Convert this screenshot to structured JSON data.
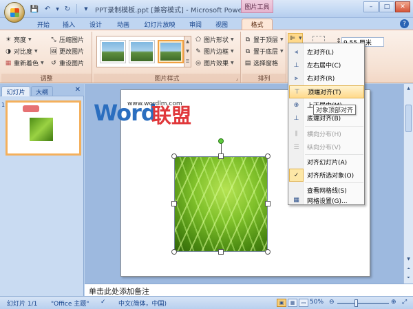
{
  "window": {
    "title": "PPT录制模板.ppt [兼容模式] - Microsoft PowerP...",
    "context_tab_title": "图片工具",
    "controls": {
      "minimize": "–",
      "maximize": "□",
      "close": "✕"
    }
  },
  "tabs": [
    "开始",
    "插入",
    "设计",
    "动画",
    "幻灯片放映",
    "审阅",
    "视图",
    "格式"
  ],
  "active_tab": "格式",
  "ribbon": {
    "adjust": {
      "label": "调整",
      "buttons": [
        "亮度",
        "对比度",
        "重新着色",
        "压缩图片",
        "更改图片",
        "重设图片"
      ]
    },
    "picture_styles": {
      "label": "图片样式",
      "buttons": [
        "图片形状",
        "图片边框",
        "图片效果"
      ]
    },
    "arrange": {
      "label": "排列",
      "buttons": [
        "置于顶层",
        "置于底层",
        "选择窗格"
      ]
    },
    "size": {
      "height_value": "9.55 厘米"
    }
  },
  "side_panel": {
    "tabs": [
      "幻灯片",
      "大纲"
    ],
    "close": "✕",
    "slide_number": "1"
  },
  "slide": {
    "watermark_word": "Word",
    "watermark_cn": "联盟",
    "watermark_url": "www.wordlm.com"
  },
  "notes_placeholder": "单击此处添加备注",
  "status": {
    "slide_info": "幻灯片 1/1",
    "theme": "\"Office 主题\"",
    "language": "中文(简体，中国)",
    "zoom": "50%"
  },
  "align_menu": {
    "items": [
      {
        "label": "左对齐(L)",
        "icon": "align-left-icon",
        "state": "normal"
      },
      {
        "label": "左右居中(C)",
        "icon": "align-center-icon",
        "state": "normal"
      },
      {
        "label": "右对齐(R)",
        "icon": "align-right-icon",
        "state": "normal"
      },
      {
        "label": "顶端对齐(T)",
        "icon": "align-top-icon",
        "state": "hover"
      },
      {
        "label": "上下居中(M)",
        "icon": "align-middle-icon",
        "state": "normal"
      },
      {
        "label": "底端对齐(B)",
        "icon": "align-bottom-icon",
        "state": "normal"
      },
      {
        "label": "横向分布(H)",
        "icon": "distribute-horizontal-icon",
        "state": "disabled"
      },
      {
        "label": "纵向分布(V)",
        "icon": "distribute-vertical-icon",
        "state": "disabled"
      },
      {
        "label": "对齐幻灯片(A)",
        "icon": "",
        "state": "normal"
      },
      {
        "label": "对齐所选对象(O)",
        "icon": "check-icon",
        "state": "checked"
      },
      {
        "label": "查看网格线(S)",
        "icon": "",
        "state": "normal"
      },
      {
        "label": "网格设置(G)...",
        "icon": "grid-icon",
        "state": "normal"
      }
    ],
    "tooltip": "对象顶部对齐"
  },
  "colors": {
    "ribbon_bg": "#f6e2d4",
    "menu_hover": "#ffd98a",
    "watermark_blue": "#2b6ebf",
    "watermark_red": "#e0373a"
  }
}
